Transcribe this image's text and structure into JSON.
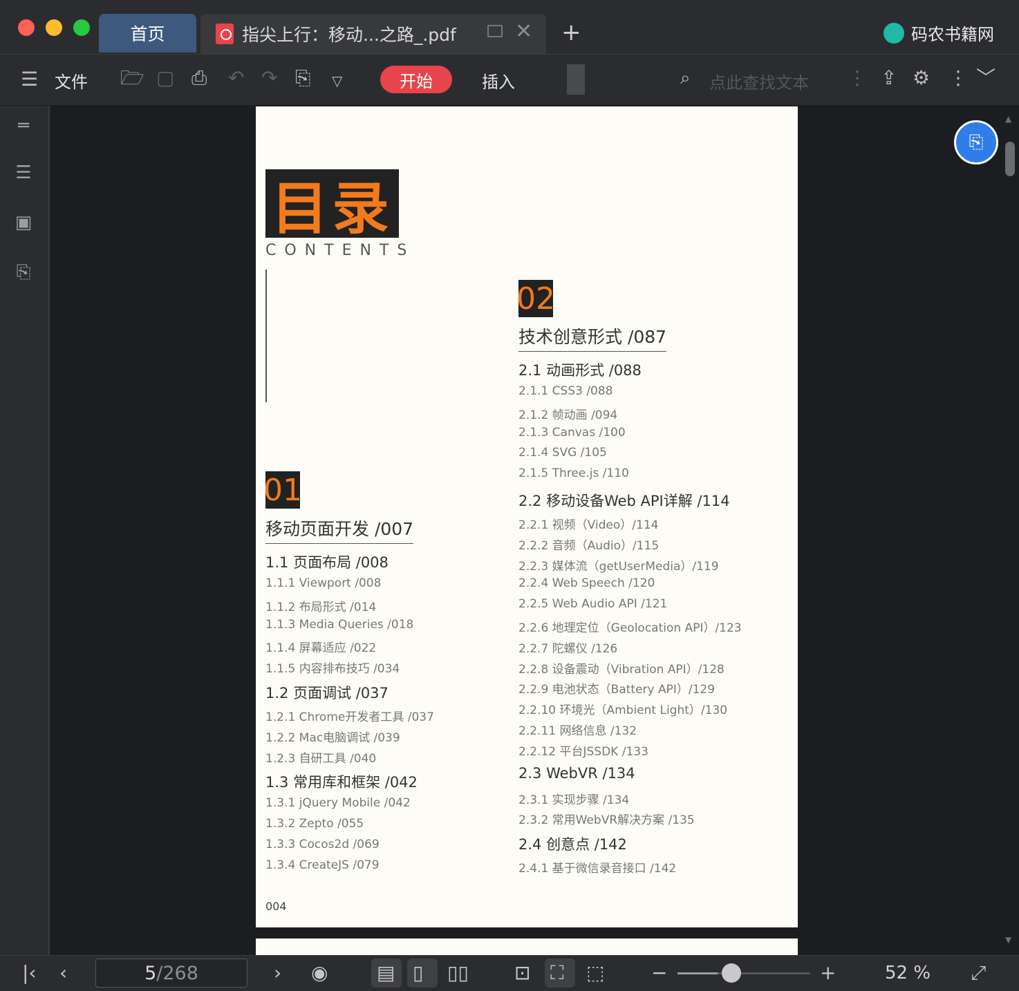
{
  "window": {
    "home_tab": "首页",
    "doc_tab": "指尖上行：移动...之路_.pdf",
    "brand": "码农书籍网",
    "colors": {
      "close": "#fe5f57",
      "minimize": "#febc2e",
      "maximize": "#28c840",
      "accent": "#e6454b"
    }
  },
  "toolbar": {
    "file_label": "文件",
    "start_label": "开始",
    "insert_label": "插入",
    "search_placeholder": "点此查找文本"
  },
  "document": {
    "toc_title": "目录",
    "contents_label": "CONTENTS",
    "page_number": "004",
    "chapters": [
      {
        "num": "01",
        "title": "移动页面开发 /007",
        "sections": [
          {
            "title": "1.1  页面布局 /008",
            "items": [
              "1.1.1  Viewport /008",
              "1.1.2  布局形式 /014",
              "1.1.3  Media Queries /018",
              "1.1.4  屏幕适应 /022",
              "1.1.5  内容排布技巧 /034"
            ]
          },
          {
            "title": "1.2  页面调试 /037",
            "items": [
              "1.2.1  Chrome开发者工具 /037",
              "1.2.2  Mac电脑调试 /039",
              "1.2.3  自研工具 /040"
            ]
          },
          {
            "title": "1.3  常用库和框架 /042",
            "items": [
              "1.3.1  jQuery Mobile /042",
              "1.3.2  Zepto /055",
              "1.3.3  Cocos2d /069",
              "1.3.4  CreateJS /079"
            ]
          }
        ]
      },
      {
        "num": "02",
        "title": "技术创意形式 /087",
        "sections": [
          {
            "title": "2.1  动画形式 /088",
            "items": [
              "2.1.1  CSS3 /088",
              "2.1.2  帧动画 /094",
              "2.1.3  Canvas /100",
              "2.1.4  SVG /105",
              "2.1.5  Three.js /110"
            ]
          },
          {
            "title": "2.2  移动设备Web API详解 /114",
            "items": [
              "2.2.1  视频（Video）/114",
              "2.2.2  音频（Audio）/115",
              "2.2.3  媒体流（getUserMedia）/119",
              "2.2.4  Web Speech /120",
              "2.2.5  Web Audio API /121",
              "2.2.6  地理定位（Geolocation API）/123",
              "2.2.7  陀螺仪 /126",
              "2.2.8  设备震动（Vibration API）/128",
              "2.2.9  电池状态（Battery API）/129",
              "2.2.10  环境光（Ambient Light）/130",
              "2.2.11  网络信息 /132",
              "2.2.12  平台JSSDK /133"
            ]
          },
          {
            "title": "2.3  WebVR /134",
            "items": [
              "2.3.1  实现步骤 /134",
              "2.3.2  常用WebVR解决方案 /135"
            ]
          },
          {
            "title": "2.4  创意点 /142",
            "items": [
              "2.4.1  基于微信录音接口 /142"
            ]
          }
        ]
      }
    ]
  },
  "statusbar": {
    "current_page": "5",
    "total_pages": "/268",
    "zoom": "52 %",
    "zoom_fraction": 0.3
  }
}
